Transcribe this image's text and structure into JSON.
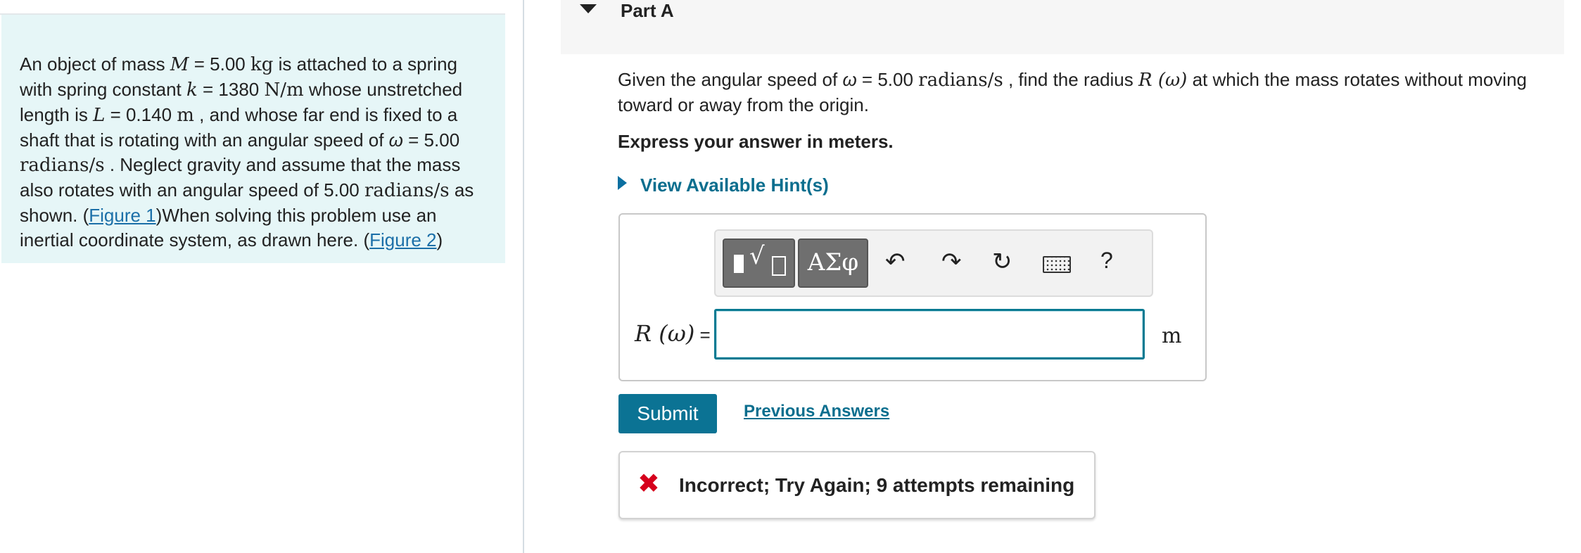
{
  "problem": {
    "t1": "An object of mass ",
    "M_sym": "M",
    "t2": " = 5.00 ",
    "kg": "kg",
    "t3": " is attached to a spring with spring constant ",
    "k_sym": "k",
    "t4": " = 1380 ",
    "Nm": "N/m",
    "t5": " whose unstretched length is ",
    "L_sym": "L",
    "t6": " = 0.140 ",
    "m1": "m",
    "t7": " , and whose far end is fixed to a shaft that is rotating with an angular speed of ",
    "w_sym": "ω",
    "t8": " = 5.00 ",
    "rads1": "radians/s",
    "t9": " . Neglect gravity and assume that the mass also rotates with an angular speed of 5.00 ",
    "rads2": "radians/s",
    "t10": " as shown. (",
    "fig1": "Figure 1",
    "t11": ")When solving this problem use an inertial coordinate system, as drawn here. (",
    "fig2": "Figure 2",
    "t12": ")"
  },
  "part": {
    "title": "Part A"
  },
  "question": {
    "q1": "Given the angular speed of ",
    "w_sym": "ω",
    "q2": " = 5.00 ",
    "rads": "radians/s",
    "q3": " , find the radius ",
    "R_expr": "R (ω)",
    "q4": " at which the mass rotates without moving toward or away from the origin.",
    "instruction": "Express your answer in meters.",
    "hint": "View Available Hint(s)"
  },
  "toolbar": {
    "greek": "ΑΣφ",
    "undo": "↶",
    "redo": "↷",
    "reset": "↻",
    "help": "?"
  },
  "answer": {
    "label": "R (ω)",
    "equals": " =",
    "value": "",
    "unit": "m"
  },
  "actions": {
    "submit": "Submit",
    "previous": "Previous Answers"
  },
  "feedback": {
    "icon": "✖",
    "text": "Incorrect; Try Again; 9 attempts remaining"
  },
  "colors": {
    "accent": "#0b7394",
    "link": "#1b6fa8",
    "error": "#d6001c",
    "problem_bg": "#e6f6f7"
  }
}
